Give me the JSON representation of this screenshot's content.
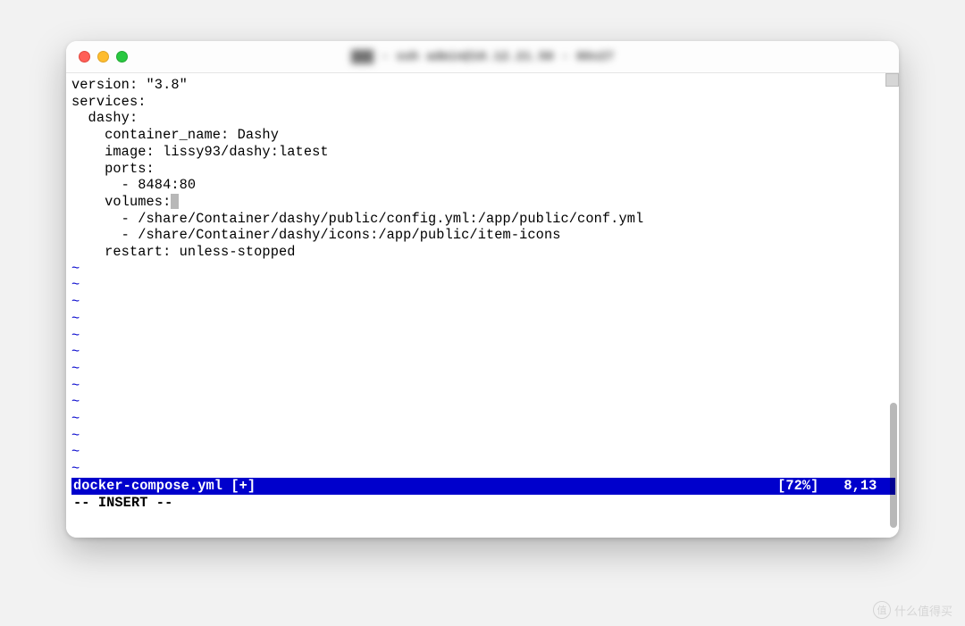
{
  "titlebar": {
    "blurred_title": "▓▓▓ - ssh admin@10.12.21.50 - 80x27"
  },
  "editor": {
    "lines": [
      "version: \"3.8\"",
      "services:",
      "  dashy:",
      "    container_name: Dashy",
      "    image: lissy93/dashy:latest",
      "    ports:",
      "      - 8484:80",
      "    volumes:",
      "      - /share/Container/dashy/public/config.yml:/app/public/conf.yml",
      "      - /share/Container/dashy/icons:/app/public/item-icons",
      "    restart: unless-stopped"
    ],
    "cursor_line_index": 7,
    "empty_line_marker": "~",
    "empty_line_count": 13
  },
  "status": {
    "filename": "docker-compose.yml [+]",
    "percent": "[72%]",
    "position": "8,13"
  },
  "mode": {
    "text": "-- INSERT --"
  },
  "watermark": {
    "icon_text": "值",
    "text": "什么值得买"
  }
}
